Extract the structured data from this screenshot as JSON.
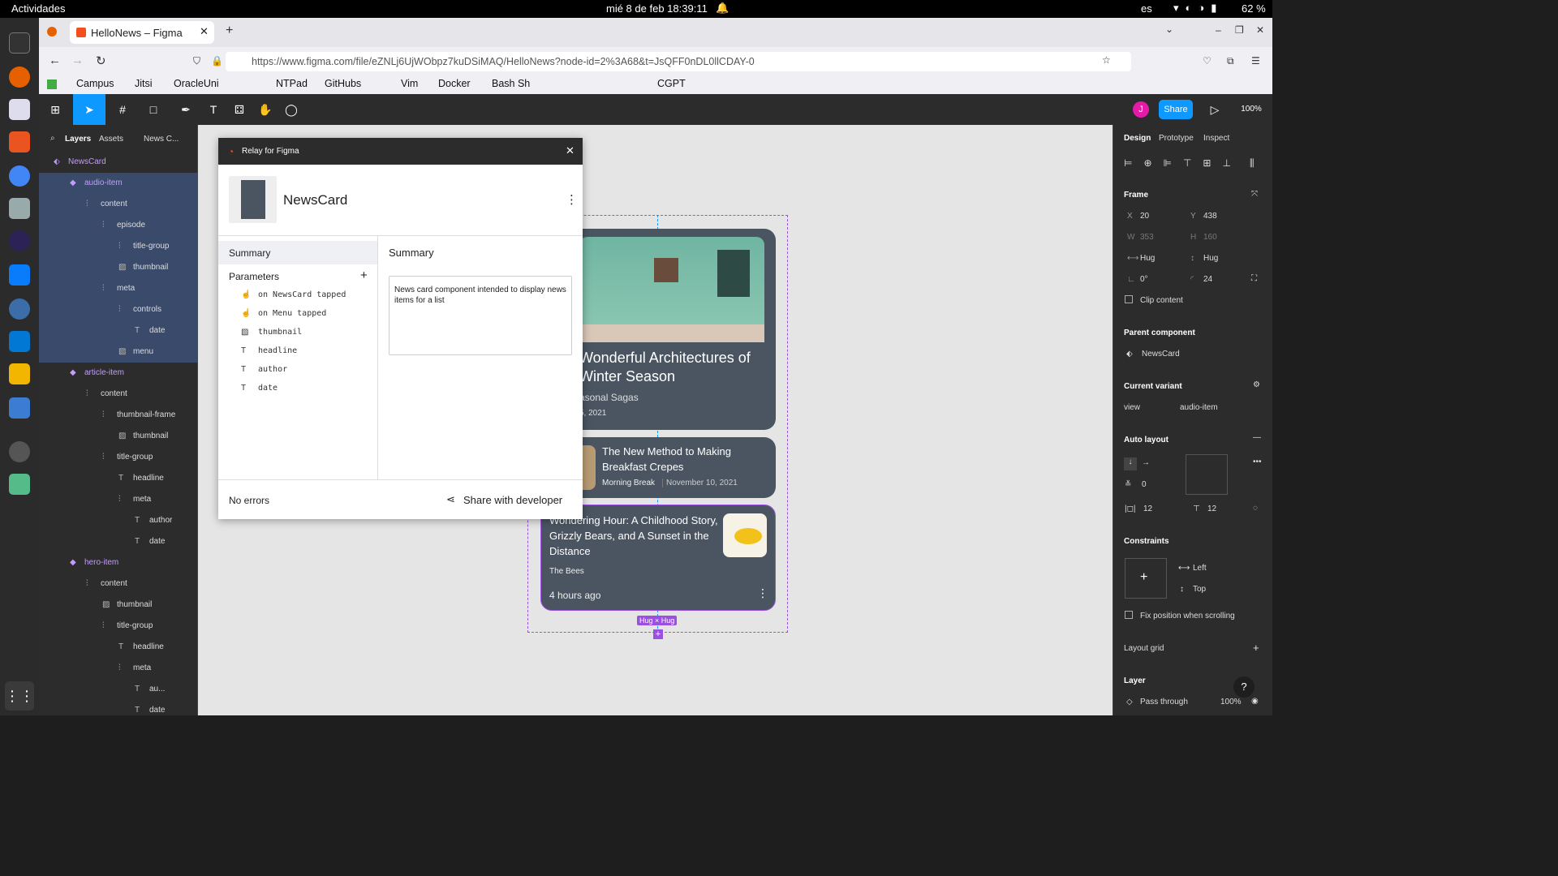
{
  "topbar": {
    "activities": "Actividades",
    "datetime": "mié 8 de feb  18:39:11",
    "lang": "es",
    "battery": "62 %"
  },
  "browser": {
    "tab_title": "HelloNews – Figma",
    "url": "https://www.figma.com/file/eZNLj6UjWObpz7kuDSiMAQ/HelloNews?node-id=2%3A68&t=JsQFF0nDL0llCDAY-0",
    "bookmarks": [
      "Campus",
      "Jitsi",
      "OracleUni",
      "NTPad",
      "GitHubs",
      "Vim",
      "Docker",
      "Bash Sh",
      "CGPT"
    ]
  },
  "figma": {
    "avatar": "J",
    "share": "Share",
    "zoom": "100%"
  },
  "layers_panel": {
    "tabs": [
      "Layers",
      "Assets"
    ],
    "page": "News C...",
    "items": [
      {
        "label": "NewsCard",
        "type": "component"
      },
      {
        "label": "audio-item",
        "type": "variant"
      },
      {
        "label": "content",
        "type": "autolayout"
      },
      {
        "label": "episode",
        "type": "autolayout"
      },
      {
        "label": "title-group",
        "type": "autolayout"
      },
      {
        "label": "thumbnail",
        "type": "image"
      },
      {
        "label": "meta",
        "type": "autolayout"
      },
      {
        "label": "controls",
        "type": "autolayout"
      },
      {
        "label": "date",
        "type": "text"
      },
      {
        "label": "menu",
        "type": "image"
      },
      {
        "label": "article-item",
        "type": "variant"
      },
      {
        "label": "content",
        "type": "autolayout"
      },
      {
        "label": "thumbnail-frame",
        "type": "autolayout"
      },
      {
        "label": "thumbnail",
        "type": "image"
      },
      {
        "label": "title-group",
        "type": "autolayout"
      },
      {
        "label": "headline",
        "type": "text"
      },
      {
        "label": "meta",
        "type": "autolayout"
      },
      {
        "label": "author",
        "type": "text"
      },
      {
        "label": "date",
        "type": "text"
      },
      {
        "label": "hero-item",
        "type": "variant"
      },
      {
        "label": "content",
        "type": "autolayout"
      },
      {
        "label": "thumbnail",
        "type": "image"
      },
      {
        "label": "title-group",
        "type": "autolayout"
      },
      {
        "label": "headline",
        "type": "text"
      },
      {
        "label": "meta",
        "type": "autolayout"
      },
      {
        "label": "au...",
        "type": "text"
      },
      {
        "label": "date",
        "type": "text"
      }
    ]
  },
  "relay": {
    "title": "Relay for Figma",
    "component": "NewsCard",
    "nav": [
      "Summary",
      "Parameters"
    ],
    "params": [
      "on NewsCard tapped",
      "on Menu tapped",
      "thumbnail",
      "headline",
      "author",
      "date"
    ],
    "summary_title": "Summary",
    "summary_text": "News card component intended to display news items for a list",
    "status": "No errors",
    "share_dev": "Share with developer"
  },
  "cards": {
    "hero": {
      "headline": "Wonderful Architectures of Winter Season",
      "author": "asonal Sagas",
      "date": "5, 2021"
    },
    "article": {
      "headline": "The New Method to Making Breakfast Crepes",
      "author": "Morning Break",
      "date": "November 10, 2021"
    },
    "audio": {
      "headline": "Wondering Hour: A Childhood Story, Grizzly Bears, and A Sunset in the Distance",
      "author": "The Bees",
      "date": "4 hours ago"
    },
    "size_tag": "Hug × Hug"
  },
  "right_panel": {
    "tabs": [
      "Design",
      "Prototype",
      "Inspect"
    ],
    "frame": "Frame",
    "x": "20",
    "y": "438",
    "w": "353",
    "h": "160",
    "wmode": "Hug",
    "hmode": "Hug",
    "rotation": "0°",
    "radius": "24",
    "clip": "Clip content",
    "parent_title": "Parent component",
    "parent": "NewsCard",
    "variant_title": "Current variant",
    "variant_key": "view",
    "variant_val": "audio-item",
    "autolayout": "Auto layout",
    "spacing": "0",
    "padh": "12",
    "padv": "12",
    "constraints": "Constraints",
    "c_h": "Left",
    "c_v": "Top",
    "fix": "Fix position when scrolling",
    "layout_grid": "Layout grid",
    "layer": "Layer",
    "blend": "Pass through",
    "opacity": "100%"
  }
}
